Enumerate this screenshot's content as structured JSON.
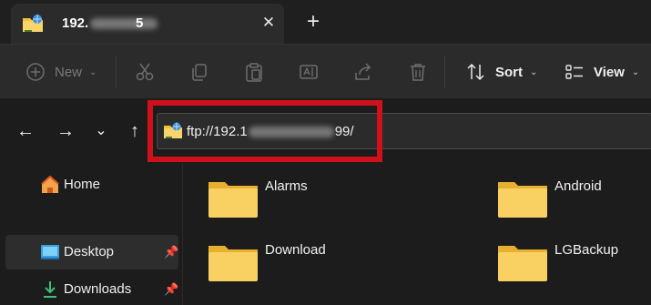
{
  "tab": {
    "title_start": "192.",
    "title_end": "5",
    "close_glyph": "✕",
    "new_tab_glyph": "+"
  },
  "toolbar": {
    "new_label": "New",
    "sort_label": "Sort",
    "view_label": "View"
  },
  "address": {
    "text_start": "ftp://192.1",
    "text_end": "99/"
  },
  "sidebar": {
    "items": [
      {
        "label": "Home",
        "icon": "home-icon"
      },
      {
        "label": "Desktop",
        "icon": "desktop-icon"
      },
      {
        "label": "Downloads",
        "icon": "download-arrow-icon"
      }
    ]
  },
  "folders": [
    {
      "label": "Alarms"
    },
    {
      "label": "Android"
    },
    {
      "label": "Download"
    },
    {
      "label": "LGBackup"
    }
  ],
  "colors": {
    "highlight_box": "#d0111b",
    "folder_yellow": "#f7c948",
    "background": "#1c1c1c"
  }
}
